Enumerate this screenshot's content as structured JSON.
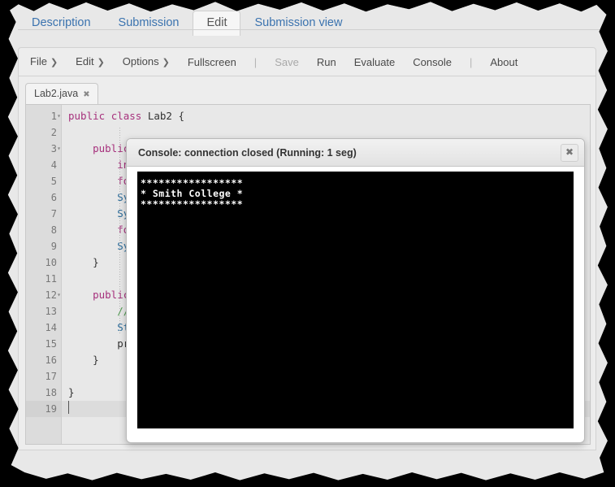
{
  "page_tabs": [
    {
      "label": "Description",
      "active": false
    },
    {
      "label": "Submission",
      "active": false
    },
    {
      "label": "Edit",
      "active": true
    },
    {
      "label": "Submission view",
      "active": false
    }
  ],
  "menubar": {
    "items": [
      {
        "label": "File",
        "caret": "❯",
        "disabled": false,
        "separator": false
      },
      {
        "label": "Edit",
        "caret": "❯",
        "disabled": false,
        "separator": false
      },
      {
        "label": "Options",
        "caret": "❯",
        "disabled": false,
        "separator": false
      },
      {
        "label": "Fullscreen",
        "caret": "",
        "disabled": false,
        "separator": false
      },
      {
        "label": "|",
        "caret": "",
        "disabled": false,
        "separator": true
      },
      {
        "label": "Save",
        "caret": "",
        "disabled": true,
        "separator": false
      },
      {
        "label": "Run",
        "caret": "",
        "disabled": false,
        "separator": false
      },
      {
        "label": "Evaluate",
        "caret": "",
        "disabled": false,
        "separator": false
      },
      {
        "label": "Console",
        "caret": "",
        "disabled": false,
        "separator": false
      },
      {
        "label": "|",
        "caret": "",
        "disabled": false,
        "separator": true
      },
      {
        "label": "About",
        "caret": "",
        "disabled": false,
        "separator": false
      }
    ]
  },
  "file_tabs": [
    {
      "label": "Lab2.java",
      "close_icon": "✖",
      "active": true
    }
  ],
  "editor": {
    "current_line": 19,
    "lines": [
      {
        "n": 1,
        "fold": true,
        "text": "public class Lab2 {",
        "tokens": [
          {
            "t": "public",
            "c": "kw"
          },
          {
            "t": " ",
            "c": "pun"
          },
          {
            "t": "class",
            "c": "kw"
          },
          {
            "t": " Lab2 {",
            "c": "pun"
          }
        ]
      },
      {
        "n": 2,
        "fold": false,
        "text": "",
        "tokens": []
      },
      {
        "n": 3,
        "fold": true,
        "text": "    public",
        "tokens": [
          {
            "t": "    ",
            "c": "pun"
          },
          {
            "t": "public",
            "c": "kw"
          }
        ]
      },
      {
        "n": 4,
        "fold": false,
        "text": "        int",
        "tokens": [
          {
            "t": "        ",
            "c": "pun"
          },
          {
            "t": "int",
            "c": "kw"
          }
        ]
      },
      {
        "n": 5,
        "fold": false,
        "text": "        for",
        "tokens": [
          {
            "t": "        ",
            "c": "pun"
          },
          {
            "t": "for",
            "c": "kw"
          }
        ]
      },
      {
        "n": 6,
        "fold": false,
        "text": "        Sys",
        "tokens": [
          {
            "t": "        ",
            "c": "pun"
          },
          {
            "t": "Sys",
            "c": "typ"
          }
        ]
      },
      {
        "n": 7,
        "fold": false,
        "text": "        Sys",
        "tokens": [
          {
            "t": "        ",
            "c": "pun"
          },
          {
            "t": "Sys",
            "c": "typ"
          }
        ]
      },
      {
        "n": 8,
        "fold": false,
        "text": "        for",
        "tokens": [
          {
            "t": "        ",
            "c": "pun"
          },
          {
            "t": "for",
            "c": "kw"
          }
        ]
      },
      {
        "n": 9,
        "fold": false,
        "text": "        Sys",
        "tokens": [
          {
            "t": "        ",
            "c": "pun"
          },
          {
            "t": "Sys",
            "c": "typ"
          }
        ]
      },
      {
        "n": 10,
        "fold": false,
        "text": "    }",
        "tokens": [
          {
            "t": "    }",
            "c": "pun"
          }
        ]
      },
      {
        "n": 11,
        "fold": false,
        "text": "",
        "tokens": []
      },
      {
        "n": 12,
        "fold": true,
        "text": "    public",
        "tokens": [
          {
            "t": "    ",
            "c": "pun"
          },
          {
            "t": "public",
            "c": "kw"
          }
        ]
      },
      {
        "n": 13,
        "fold": false,
        "text": "        //",
        "tokens": [
          {
            "t": "        ",
            "c": "pun"
          },
          {
            "t": "//",
            "c": "cmt"
          }
        ]
      },
      {
        "n": 14,
        "fold": false,
        "text": "        Str",
        "tokens": [
          {
            "t": "        ",
            "c": "pun"
          },
          {
            "t": "Str",
            "c": "typ"
          }
        ]
      },
      {
        "n": 15,
        "fold": false,
        "text": "        pri",
        "tokens": [
          {
            "t": "        ",
            "c": "pun"
          },
          {
            "t": "pri",
            "c": "pun"
          }
        ]
      },
      {
        "n": 16,
        "fold": false,
        "text": "    }",
        "tokens": [
          {
            "t": "    }",
            "c": "pun"
          }
        ]
      },
      {
        "n": 17,
        "fold": false,
        "text": "",
        "tokens": []
      },
      {
        "n": 18,
        "fold": false,
        "text": "}",
        "tokens": [
          {
            "t": "}",
            "c": "pun"
          }
        ]
      },
      {
        "n": 19,
        "fold": false,
        "text": "",
        "tokens": []
      }
    ]
  },
  "dialog": {
    "title": "Console: connection closed (Running: 1 seg)",
    "close_icon": "✖",
    "output_lines": [
      "*****************",
      "* Smith College *",
      "*****************"
    ]
  },
  "colors": {
    "page_bg": "#e8e8e8",
    "tab_link": "#3b73af",
    "keyword": "#a6307c",
    "type": "#2a6b9a",
    "comment": "#4d9a4d",
    "console_bg": "#000000",
    "console_fg": "#ffffff"
  }
}
